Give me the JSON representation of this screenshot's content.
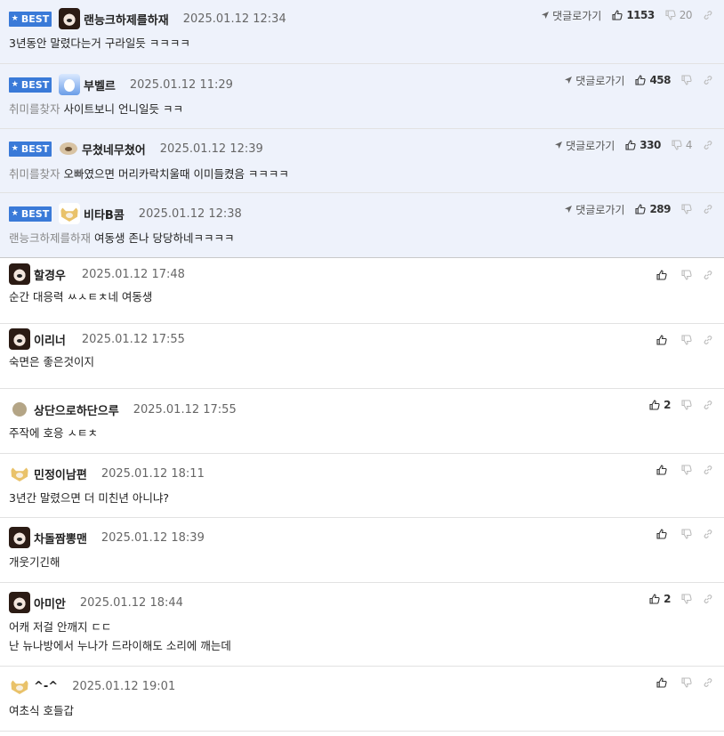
{
  "labels": {
    "best_badge": "BEST",
    "reply_link": "댓글로가기"
  },
  "best": [
    {
      "nick": "랜능크하제를하재",
      "date": "2025.01.12 12:34",
      "reply_to": "",
      "text": "3년동안 말렸다는거 구라일듯 ㅋㅋㅋㅋ",
      "up": "1153",
      "down": "20",
      "avatar": "bear"
    },
    {
      "nick": "부벨르",
      "date": "2025.01.12 11:29",
      "reply_to": "취미를찾자",
      "text": "사이트보니 언니일듯 ㅋㅋ",
      "up": "458",
      "down": "",
      "avatar": "bunny"
    },
    {
      "nick": "무쳤네무쳤어",
      "date": "2025.01.12 12:39",
      "reply_to": "취미를찾자",
      "text": "오빠였으면 머리카락치울때 이미들켰음 ㅋㅋㅋㅋ",
      "up": "330",
      "down": "4",
      "avatar": "pup"
    },
    {
      "nick": "비타B콤",
      "date": "2025.01.12 12:38",
      "reply_to": "랜능크하제를하재",
      "text": "여동생 존나 당당하네ㅋㅋㅋㅋ",
      "up": "289",
      "down": "",
      "avatar": "dog"
    }
  ],
  "comments": [
    {
      "nick": "할경우",
      "date": "2025.01.12 17:48",
      "lines": [
        "순간 대응력 ㅆㅅㅌㅊ네 여동생"
      ],
      "up": "",
      "avatar": "bear"
    },
    {
      "nick": "이리너",
      "date": "2025.01.12 17:55",
      "lines": [
        "숙면은 좋은것이지"
      ],
      "up": "",
      "avatar": "bear"
    },
    {
      "nick": "상단으로하단으루",
      "date": "2025.01.12 17:55",
      "lines": [
        "주작에 호응 ㅅㅌㅊ"
      ],
      "up": "2",
      "avatar": "dot"
    },
    {
      "nick": "민정이남편",
      "date": "2025.01.12 18:11",
      "lines": [
        "3년간 말렸으면 더 미친년 아니냐?"
      ],
      "up": "",
      "avatar": "dog"
    },
    {
      "nick": "차돌짬뽕맨",
      "date": "2025.01.12 18:39",
      "lines": [
        "개웃기긴해"
      ],
      "up": "",
      "avatar": "bear"
    },
    {
      "nick": "아미안",
      "date": "2025.01.12 18:44",
      "lines": [
        "어캐 저걸 안깨지 ㄷㄷ",
        "난 뉴나방에서 누나가 드라이해도 소리에 깨는데"
      ],
      "up": "2",
      "avatar": "bear"
    },
    {
      "nick": "^-^",
      "date": "2025.01.12 19:01",
      "lines": [
        "여초식 호들갑"
      ],
      "up": "",
      "avatar": "dog"
    }
  ]
}
